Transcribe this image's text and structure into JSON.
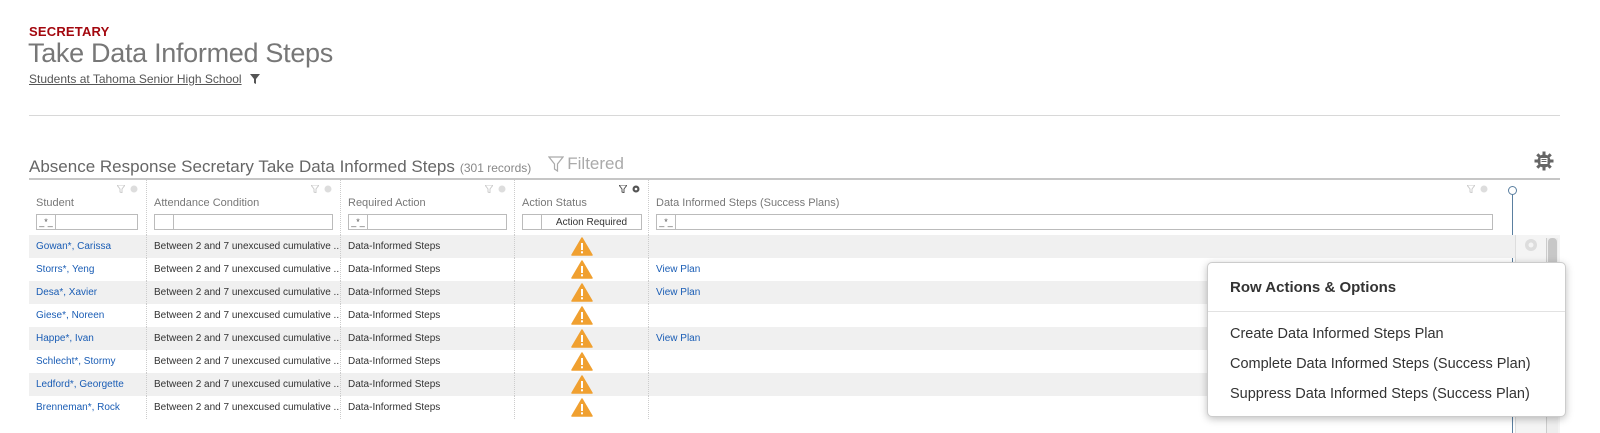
{
  "page": {
    "role": "SECRETARY",
    "title": "Take Data Informed Steps",
    "context_link": "Students at Tahoma Senior High School"
  },
  "grid": {
    "title": "Absence Response Secretary Take Data Informed Steps",
    "record_count": "(301 records)",
    "filtered_label": "Filtered",
    "columns": [
      {
        "label": "Student",
        "filter_prefix": "_*_",
        "filter_value": ""
      },
      {
        "label": "Attendance Condition",
        "filter_prefix": "",
        "filter_value": ""
      },
      {
        "label": "Required Action",
        "filter_prefix": "_*_",
        "filter_value": ""
      },
      {
        "label": "Action Status",
        "filter_prefix": "",
        "filter_value": "Action Required"
      },
      {
        "label": "Data Informed Steps (Success Plans)",
        "filter_prefix": "_*_",
        "filter_value": ""
      }
    ],
    "rows": [
      {
        "student": "Gowan*, Carissa",
        "condition": "Between 2 and 7 unexcused cumulative ...",
        "action": "Data-Informed Steps",
        "status_icon": "warning-icon",
        "plan": ""
      },
      {
        "student": "Storrs*, Yeng",
        "condition": "Between 2 and 7 unexcused cumulative ...",
        "action": "Data-Informed Steps",
        "status_icon": "warning-icon",
        "plan": "View Plan"
      },
      {
        "student": "Desa*, Xavier",
        "condition": "Between 2 and 7 unexcused cumulative ...",
        "action": "Data-Informed Steps",
        "status_icon": "warning-icon",
        "plan": "View Plan"
      },
      {
        "student": "Giese*, Noreen",
        "condition": "Between 2 and 7 unexcused cumulative ...",
        "action": "Data-Informed Steps",
        "status_icon": "warning-icon",
        "plan": ""
      },
      {
        "student": "Happe*, Ivan",
        "condition": "Between 2 and 7 unexcused cumulative ...",
        "action": "Data-Informed Steps",
        "status_icon": "warning-icon",
        "plan": "View Plan"
      },
      {
        "student": "Schlecht*, Stormy",
        "condition": "Between 2 and 7 unexcused cumulative ...",
        "action": "Data-Informed Steps",
        "status_icon": "warning-icon",
        "plan": ""
      },
      {
        "student": "Ledford*, Georgette",
        "condition": "Between 2 and 7 unexcused cumulative ...",
        "action": "Data-Informed Steps",
        "status_icon": "warning-icon",
        "plan": ""
      },
      {
        "student": "Brenneman*, Rock",
        "condition": "Between 2 and 7 unexcused cumulative ...",
        "action": "Data-Informed Steps",
        "status_icon": "warning-icon",
        "plan": ""
      }
    ]
  },
  "popup": {
    "title": "Row Actions & Options",
    "items": [
      "Create Data Informed Steps Plan",
      "Complete Data Informed Steps (Success Plan)",
      "Suppress Data Informed Steps (Success Plan)"
    ]
  },
  "colors": {
    "role_red": "#a3070e",
    "link_blue": "#1a5db5",
    "warning_orange": "#f0a030"
  }
}
